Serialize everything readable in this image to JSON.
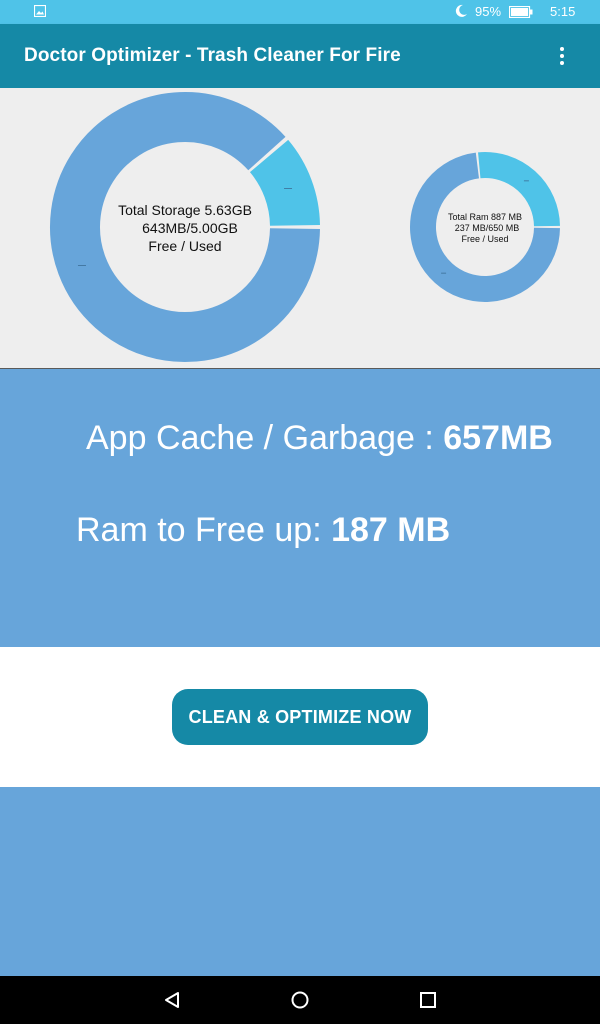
{
  "status_bar": {
    "battery": "95%",
    "time": "5:15",
    "icons": [
      "image-notification-icon",
      "moon-icon",
      "battery-icon"
    ]
  },
  "app_bar": {
    "title": "Doctor Optimizer - Trash Cleaner For Fire",
    "menu_icon": "overflow-menu-icon"
  },
  "storage_chart": {
    "line1": "Total Storage 5.63GB",
    "line2": "643MB/5.00GB",
    "line3": "Free / Used"
  },
  "ram_chart": {
    "line1": "Total Ram 887 MB",
    "line2": "237 MB/650 MB",
    "line3": "Free / Used"
  },
  "chart_data": [
    {
      "type": "pie",
      "donut": true,
      "categories": [
        "Free",
        "Used"
      ],
      "values": [
        643,
        5000
      ],
      "colors": [
        "#4fc3e8",
        "#67a5da"
      ]
    },
    {
      "type": "pie",
      "donut": true,
      "categories": [
        "Free",
        "Used"
      ],
      "values": [
        237,
        650
      ],
      "colors": [
        "#4fc3e8",
        "#67a5da"
      ]
    }
  ],
  "stats": {
    "cache_label": "App Cache / Garbage : ",
    "cache_value": "657MB",
    "ram_label": "Ram to Free up: ",
    "ram_value": "187 MB"
  },
  "action": {
    "button_label": "CLEAN & OPTIMIZE NOW"
  },
  "nav_bar": {
    "icons": [
      "back-icon",
      "home-icon",
      "recents-icon"
    ]
  },
  "colors": {
    "status_bar": "#4fc3e8",
    "app_bar": "#1589a6",
    "chart_bg": "#eeeeee",
    "panel": "#67a5da",
    "free_slice": "#4fc3e8",
    "used_slice": "#67a5da"
  }
}
